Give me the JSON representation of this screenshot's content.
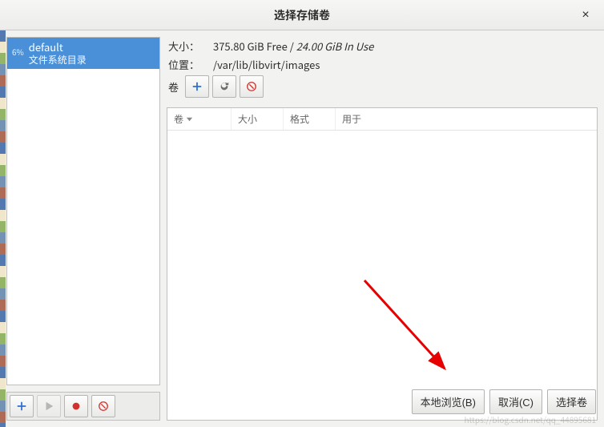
{
  "title": "选择存储卷",
  "close_label": "×",
  "pool": {
    "pct": "6%",
    "name": "default",
    "subtitle": "文件系统目录"
  },
  "pool_toolbar": {
    "add": "+",
    "start": "▶",
    "stop": "●",
    "delete": "⊘"
  },
  "info": {
    "size_label": "大小：",
    "size_free": "375.80 GiB Free",
    "size_sep": " / ",
    "size_inuse": "24.00 GiB In Use",
    "loc_label": "位置：",
    "loc_value": "/var/lib/libvirt/images",
    "vol_label": "卷"
  },
  "vol_toolbar": {
    "new": "+",
    "refresh": "↻",
    "delete": "⊘"
  },
  "vol_columns": {
    "name": "卷",
    "size": "大小",
    "format": "格式",
    "used": "用于"
  },
  "footer": {
    "browse": "本地浏览(B)",
    "cancel": "取消(C)",
    "choose": "选择卷"
  },
  "watermark": "https://blog.csdn.net/qq_44895681"
}
